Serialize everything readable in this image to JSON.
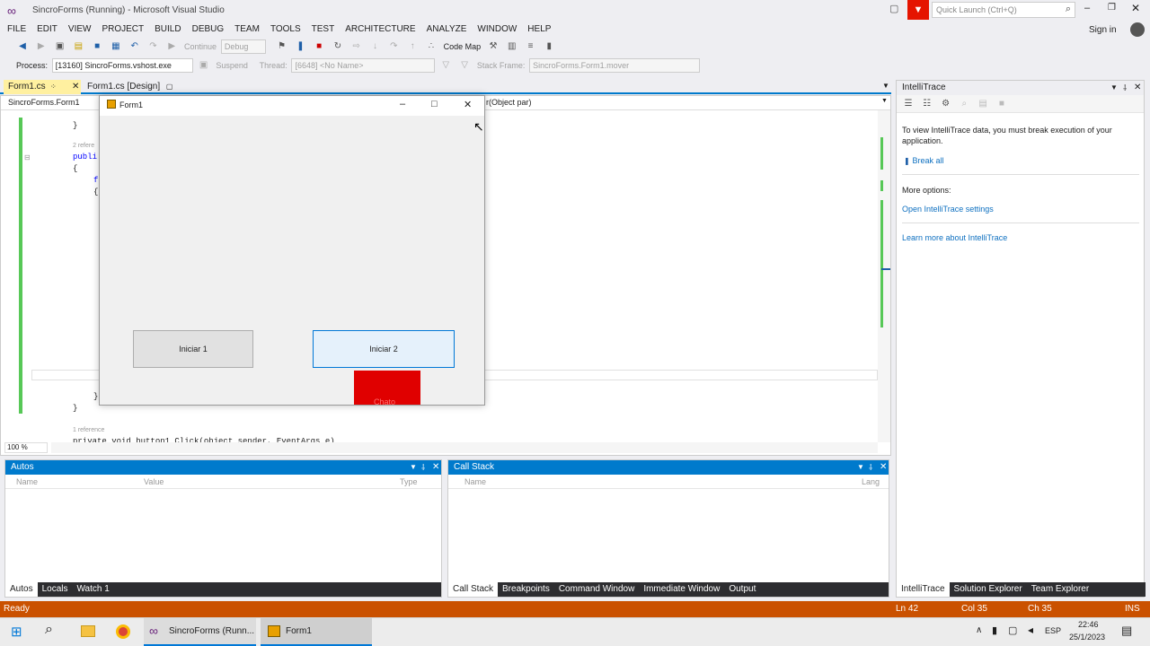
{
  "window": {
    "title": "SincroForms (Running) - Microsoft Visual Studio",
    "quick_launch_placeholder": "Quick Launch (Ctrl+Q)",
    "sign_in": "Sign in"
  },
  "menu": [
    "FILE",
    "EDIT",
    "VIEW",
    "PROJECT",
    "BUILD",
    "DEBUG",
    "TEAM",
    "TOOLS",
    "TEST",
    "ARCHITECTURE",
    "ANALYZE",
    "WINDOW",
    "HELP"
  ],
  "toolbar": {
    "continue_label": "Continue",
    "config_value": "Debug",
    "code_map_label": "Code Map"
  },
  "toolbar2": {
    "process_label": "Process:",
    "process_value": "[13160] SincroForms.vshost.exe",
    "suspend_label": "Suspend",
    "thread_label": "Thread:",
    "thread_value": "[6648] <No Name>",
    "stack_frame_label": "Stack Frame:",
    "stack_frame_value": "SincroForms.Form1.mover"
  },
  "doc_tabs": [
    "Form1.cs",
    "Form1.cs [Design]"
  ],
  "editor": {
    "class_nav": "SincroForms.Form1",
    "member_nav": "r(Object par)",
    "zoom": "100 %",
    "lines": [
      "}",
      "2 refere",
      "publi",
      "{",
      "f",
      "{"
    ],
    "bottom_lines": [
      "}",
      "}",
      "1 reference",
      "private void button1_Click(object sender, EventArgs e)"
    ]
  },
  "form1": {
    "title": "Form1",
    "button1": "Iniciar 1",
    "button2": "Iniciar 2",
    "red_box_label": "Chato",
    "red_color": "#e00000"
  },
  "intellitrace": {
    "title": "IntelliTrace",
    "message": "To view IntelliTrace data, you must break execution of your application.",
    "break_all": "Break all",
    "more_options": "More options:",
    "open_settings": "Open IntelliTrace settings",
    "learn_more": "Learn more about IntelliTrace",
    "tabs": [
      "IntelliTrace",
      "Solution Explorer",
      "Team Explorer"
    ]
  },
  "autos": {
    "title": "Autos",
    "columns": [
      "Name",
      "Value",
      "Type"
    ],
    "tabs": [
      "Autos",
      "Locals",
      "Watch 1"
    ]
  },
  "callstack": {
    "title": "Call Stack",
    "columns": [
      "Name",
      "Lang"
    ],
    "tabs": [
      "Call Stack",
      "Breakpoints",
      "Command Window",
      "Immediate Window",
      "Output"
    ]
  },
  "status": {
    "text": "Ready",
    "line": "Ln 42",
    "col": "Col 35",
    "ch": "Ch 35",
    "mode": "INS",
    "color": "#ca5100"
  },
  "taskbar": {
    "vs_item": "SincroForms (Runn...",
    "form_item": "Form1",
    "lang": "ESP",
    "time": "22:46",
    "date": "25/1/2023"
  }
}
